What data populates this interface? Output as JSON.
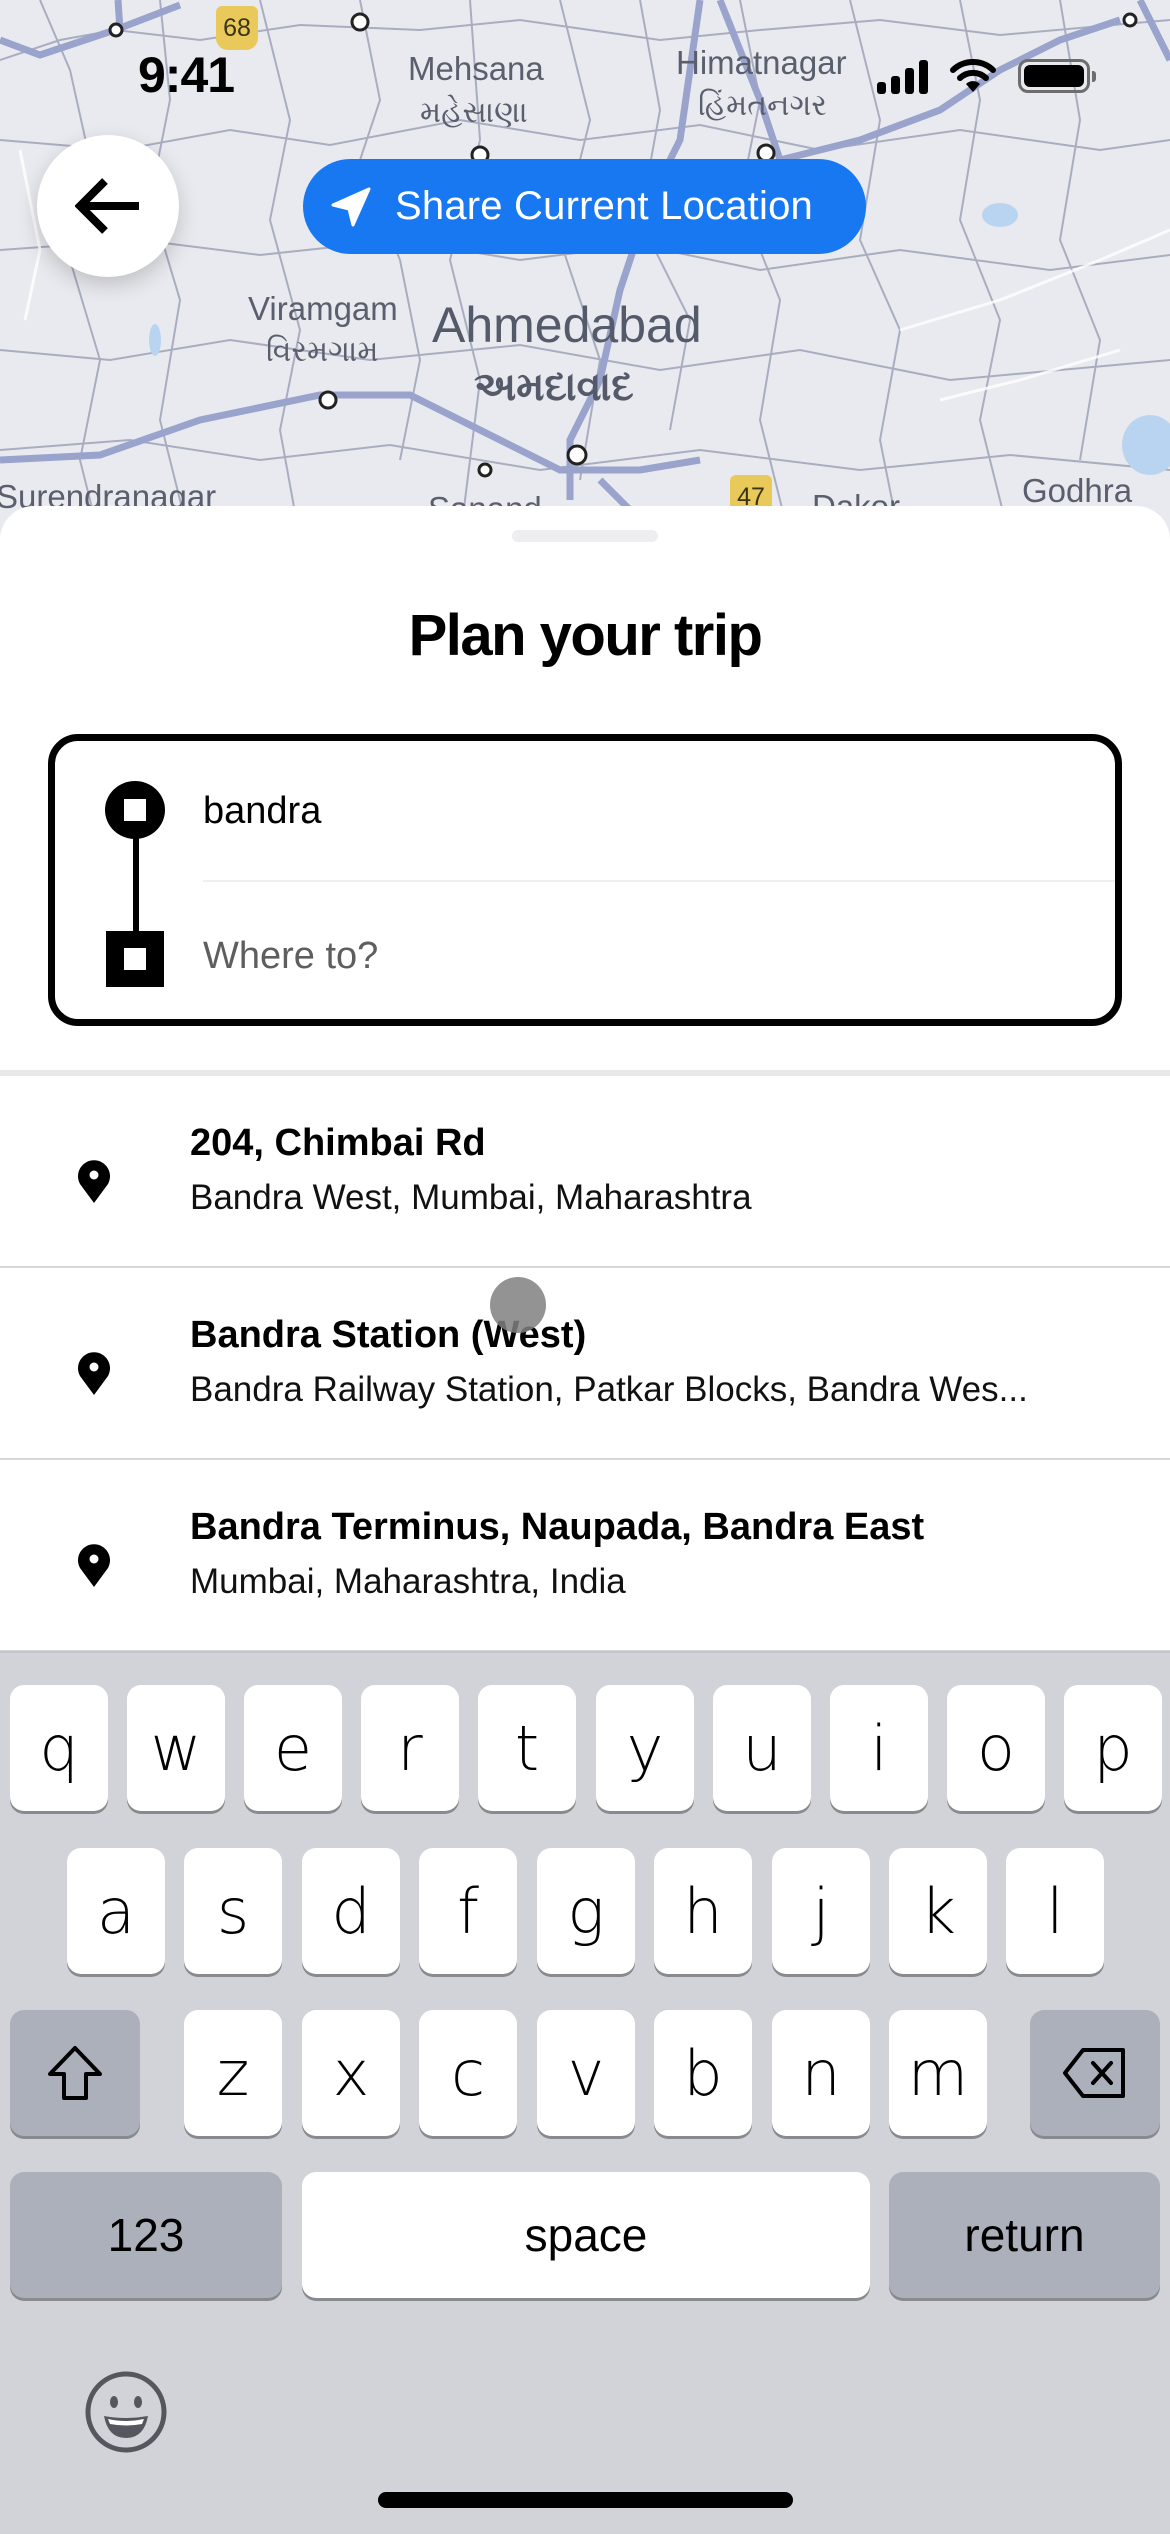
{
  "status_bar": {
    "time": "9:41",
    "icons": [
      "cellular-signal-icon",
      "wifi-icon",
      "battery-icon"
    ]
  },
  "map": {
    "labels": [
      {
        "text": "Mehsana",
        "type": "city"
      },
      {
        "text": "મહેસાણા",
        "type": "city-gj"
      },
      {
        "text": "Himatnagar",
        "type": "city"
      },
      {
        "text": "હિંમતનગર",
        "type": "city-gj"
      },
      {
        "text": "Viramgam",
        "type": "city"
      },
      {
        "text": "વિરમગામ",
        "type": "city-gj"
      },
      {
        "text": "Ahmedabad",
        "type": "major-city"
      },
      {
        "text": "અમદાવાદ",
        "type": "major-city-gj"
      },
      {
        "text": "Surendranagar",
        "type": "city"
      },
      {
        "text": "Sanand",
        "type": "city"
      },
      {
        "text": "Dakor",
        "type": "city"
      },
      {
        "text": "Godhra",
        "type": "city"
      }
    ],
    "highway_shields": [
      "68",
      "47"
    ]
  },
  "back_button": {
    "icon": "arrow-left-icon"
  },
  "share_location": {
    "label": "Share Current Location",
    "icon": "navigation-arrow-icon",
    "color": "#1778f2"
  },
  "sheet": {
    "title": "Plan your trip",
    "pickup": {
      "value": "bandra",
      "placeholder": ""
    },
    "destination": {
      "value": "",
      "placeholder": "Where to?"
    }
  },
  "results": [
    {
      "title": "204, Chimbai Rd",
      "subtitle": "Bandra West, Mumbai, Maharashtra",
      "icon": "location-pin-icon"
    },
    {
      "title": "Bandra Station (West)",
      "subtitle": "Bandra Railway Station, Patkar Blocks, Bandra Wes...",
      "icon": "location-pin-icon"
    },
    {
      "title": "Bandra Terminus, Naupada, Bandra East",
      "subtitle": "Mumbai, Maharashtra, India",
      "icon": "location-pin-icon"
    }
  ],
  "keyboard": {
    "row1": [
      "q",
      "w",
      "e",
      "r",
      "t",
      "y",
      "u",
      "i",
      "o",
      "p"
    ],
    "row2": [
      "a",
      "s",
      "d",
      "f",
      "g",
      "h",
      "j",
      "k",
      "l"
    ],
    "row3": [
      "z",
      "x",
      "c",
      "v",
      "b",
      "n",
      "m"
    ],
    "shift_icon": "shift-icon",
    "delete_icon": "delete-backspace-icon",
    "numbers_label": "123",
    "space_label": "space",
    "return_label": "return",
    "emoji_icon": "emoji-smiley-icon"
  }
}
